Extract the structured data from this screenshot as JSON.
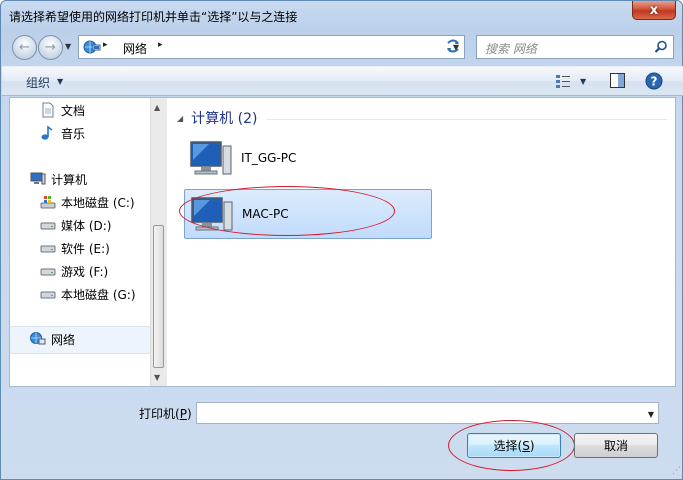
{
  "window": {
    "title": "请选择希望使用的网络打印机并单击“选择”以与之连接",
    "close_glyph": "x"
  },
  "nav": {
    "back_glyph": "←",
    "forward_glyph": "→",
    "address": {
      "path_root_arrow": "▸",
      "path": "网络",
      "path_arrow": "▸"
    },
    "search_placeholder": "搜索 网络"
  },
  "toolbar": {
    "organize_label": "组织",
    "dropdown_glyph": "▼"
  },
  "sidebar": {
    "items": [
      {
        "label": "文档",
        "icon": "document-icon"
      },
      {
        "label": "音乐",
        "icon": "music-icon"
      },
      {
        "label": "计算机",
        "icon": "computer-icon"
      },
      {
        "label": "本地磁盘 (C:)",
        "icon": "system-drive-icon"
      },
      {
        "label": "媒体 (D:)",
        "icon": "drive-icon"
      },
      {
        "label": "软件 (E:)",
        "icon": "drive-icon"
      },
      {
        "label": "游戏 (F:)",
        "icon": "drive-icon"
      },
      {
        "label": "本地磁盘 (G:)",
        "icon": "drive-icon"
      },
      {
        "label": "网络",
        "icon": "network-icon"
      }
    ]
  },
  "main": {
    "group_header": "计算机 (2)",
    "computers": [
      {
        "name": "IT_GG-PC",
        "selected": false
      },
      {
        "name": "MAC-PC",
        "selected": true
      }
    ]
  },
  "printer": {
    "label": "打印机",
    "accesskey": "P",
    "value": ""
  },
  "buttons": {
    "select_label": "选择",
    "select_accesskey": "S",
    "cancel_label": "取消"
  },
  "colors": {
    "annotation_ellipse": "#d21c2f",
    "selection": "#c1dbfc",
    "group_header": "#1e3287"
  }
}
